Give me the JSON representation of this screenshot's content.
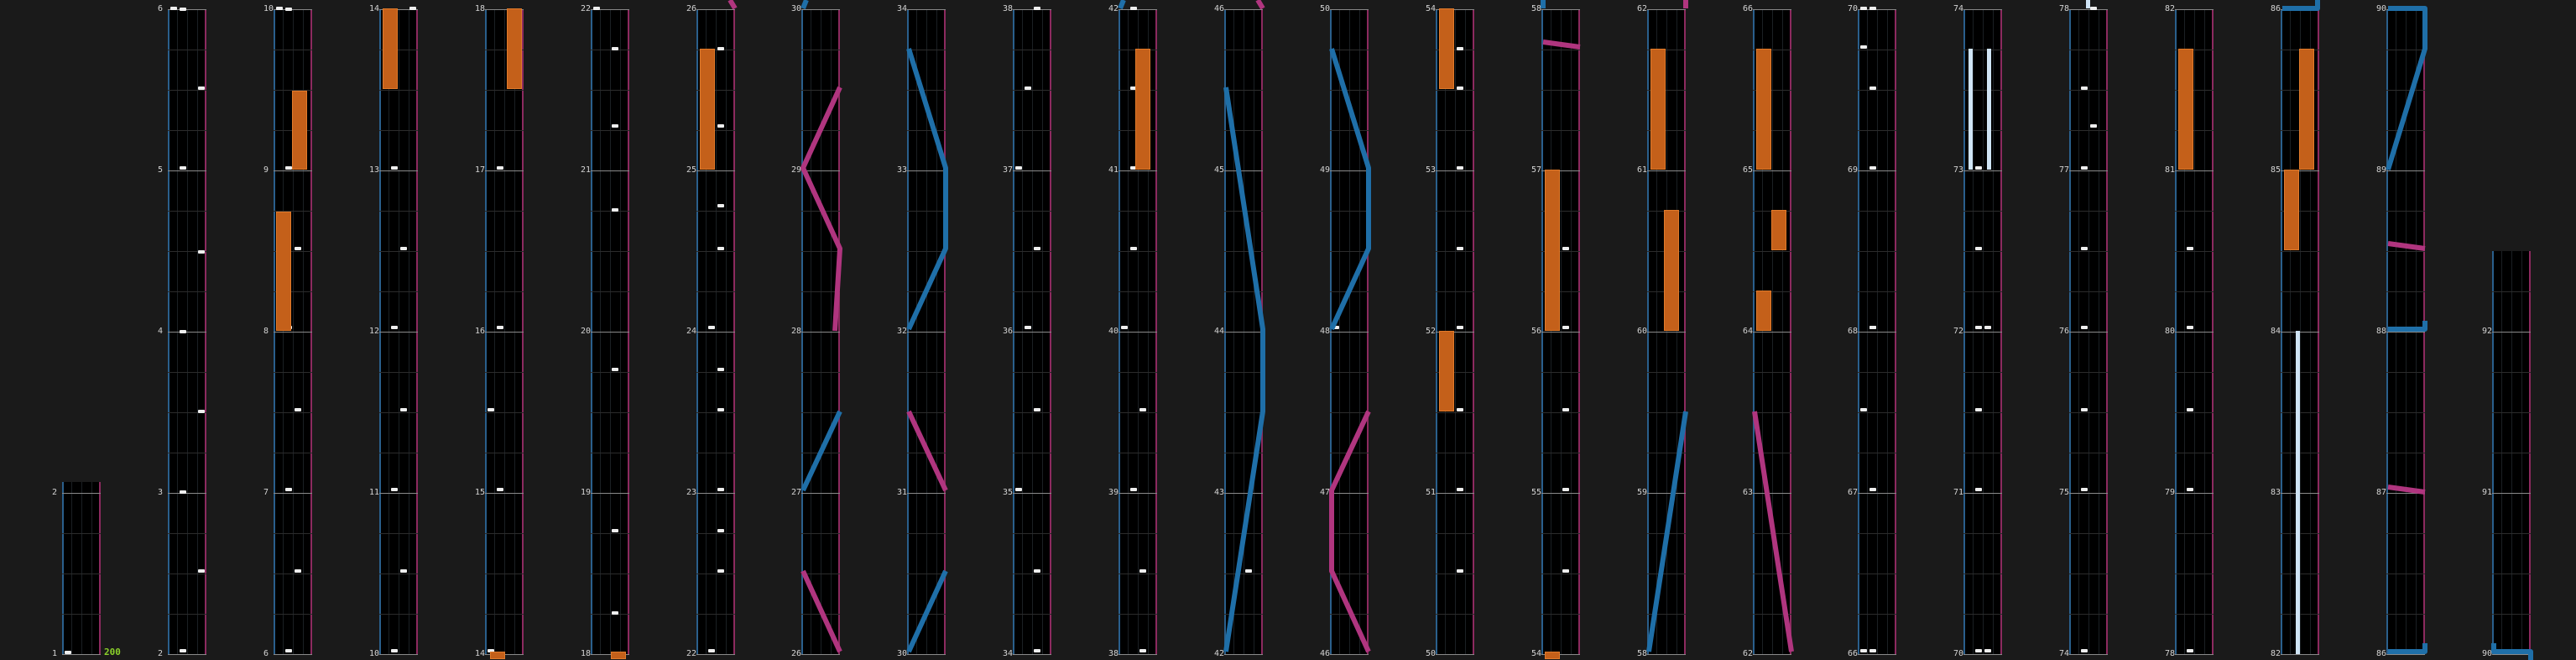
{
  "chart": {
    "combo_counter": "200",
    "lane_colors": {
      "background": "#000000",
      "left_laser": "#1f6fa8",
      "right_laser": "#b0357f",
      "hold": "#c4601a",
      "tap": "#eeeeee",
      "measure_line": "#8a8a8a"
    },
    "columns": [
      {
        "measures": [
          "1",
          "2"
        ]
      },
      {
        "measures": [
          "2",
          "3",
          "4",
          "5",
          "6"
        ]
      },
      {
        "measures": [
          "6",
          "7",
          "8",
          "9",
          "10"
        ]
      },
      {
        "measures": [
          "10",
          "11",
          "12",
          "13",
          "14"
        ]
      },
      {
        "measures": [
          "14",
          "15",
          "16",
          "17",
          "18"
        ]
      },
      {
        "measures": [
          "18",
          "19",
          "20",
          "21",
          "22"
        ]
      },
      {
        "measures": [
          "22",
          "23",
          "24",
          "25",
          "26"
        ]
      },
      {
        "measures": [
          "26",
          "27",
          "28",
          "29",
          "30"
        ]
      },
      {
        "measures": [
          "30",
          "31",
          "32",
          "33",
          "34"
        ]
      },
      {
        "measures": [
          "34",
          "35",
          "36",
          "37",
          "38"
        ]
      },
      {
        "measures": [
          "38",
          "39",
          "40",
          "41",
          "42"
        ]
      },
      {
        "measures": [
          "42",
          "43",
          "44",
          "45",
          "46"
        ]
      },
      {
        "measures": [
          "46",
          "47",
          "48",
          "49",
          "50"
        ]
      },
      {
        "measures": [
          "50",
          "51",
          "52",
          "53",
          "54"
        ]
      },
      {
        "measures": [
          "54",
          "55",
          "56",
          "57",
          "58"
        ]
      },
      {
        "measures": [
          "58",
          "59",
          "60",
          "61",
          "62"
        ]
      },
      {
        "measures": [
          "62",
          "63",
          "64",
          "65",
          "66"
        ]
      },
      {
        "measures": [
          "66",
          "67",
          "68",
          "69",
          "70"
        ]
      },
      {
        "measures": [
          "70",
          "71",
          "72",
          "73",
          "74"
        ]
      },
      {
        "measures": [
          "74",
          "75",
          "76",
          "77",
          "78"
        ]
      },
      {
        "measures": [
          "78",
          "79",
          "80",
          "81",
          "82"
        ]
      },
      {
        "measures": [
          "82",
          "83",
          "84",
          "85",
          "86"
        ]
      },
      {
        "measures": [
          "86",
          "87",
          "88",
          "89",
          "90"
        ]
      },
      {
        "measures": [
          "90",
          "91",
          "92"
        ]
      }
    ]
  }
}
